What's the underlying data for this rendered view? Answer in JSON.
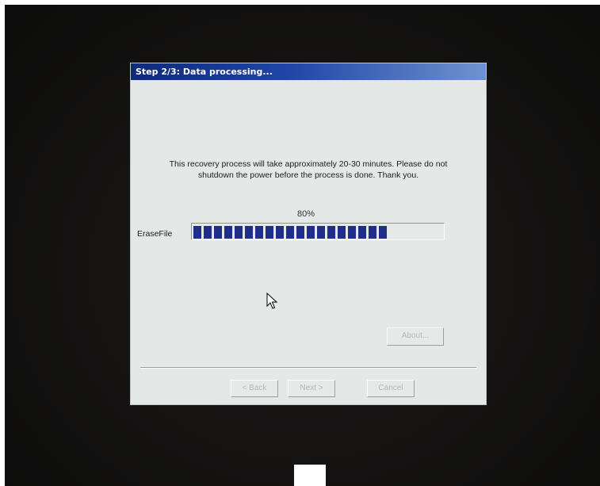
{
  "dialog": {
    "title": "Step 2/3: Data processing...",
    "message_line1": "This recovery process will take approximately 20-30 minutes.  Please do not",
    "message_line2": "shutdown the power before the process is done.  Thank you.",
    "progress": {
      "percent_text": "80%",
      "label": "EraseFile",
      "value": 0.8,
      "fill_color": "#1e2e8a"
    },
    "buttons": {
      "about": "About...",
      "back": "< Back",
      "next": "Next >",
      "cancel": "Cancel"
    }
  },
  "colors": {
    "titlebar_start": "#0d2a7a",
    "titlebar_end": "#6f93cf",
    "dialog_bg": "#e4e8e6"
  }
}
